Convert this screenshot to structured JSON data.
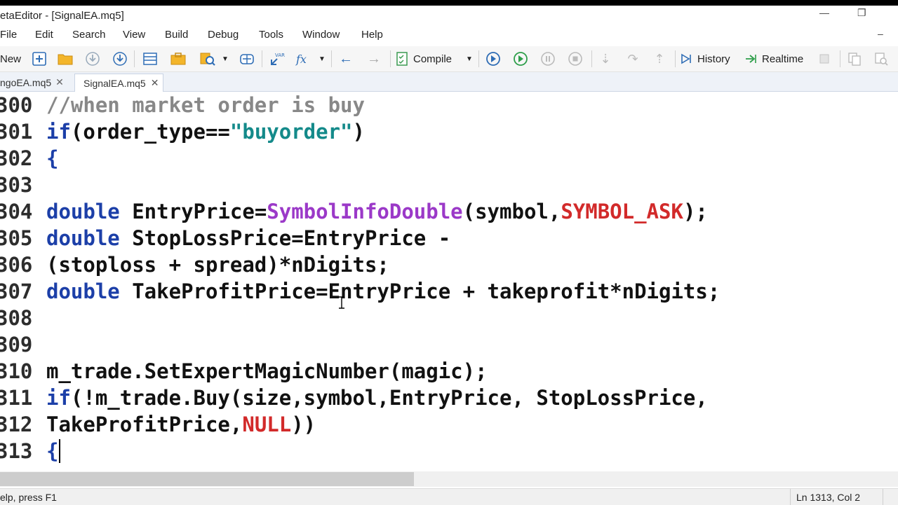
{
  "window": {
    "title": "etaEditor - [SignalEA.mq5]"
  },
  "menu": [
    "File",
    "Edit",
    "Search",
    "View",
    "Build",
    "Debug",
    "Tools",
    "Window",
    "Help"
  ],
  "toolbar": {
    "new_label": "New",
    "compile_label": "Compile",
    "history_label": "History",
    "realtime_label": "Realtime"
  },
  "tabs": [
    {
      "label": "ngoEA.mq5",
      "active": false
    },
    {
      "label": "SignalEA.mq5",
      "active": true
    }
  ],
  "code_lines": [
    {
      "num": "300",
      "segments": [
        {
          "t": "//when market order is buy",
          "c": "c"
        }
      ]
    },
    {
      "num": "301",
      "segments": [
        {
          "t": "if",
          "c": "k"
        },
        {
          "t": "(order_type==",
          "c": ""
        },
        {
          "t": "\"buyorder\"",
          "c": "s"
        },
        {
          "t": ")",
          "c": ""
        }
      ]
    },
    {
      "num": "302",
      "segments": [
        {
          "t": "{",
          "c": "k"
        }
      ]
    },
    {
      "num": "303",
      "segments": []
    },
    {
      "num": "304",
      "segments": [
        {
          "t": "double",
          "c": "k"
        },
        {
          "t": " EntryPrice=",
          "c": ""
        },
        {
          "t": "SymbolInfoDouble",
          "c": "f"
        },
        {
          "t": "(symbol,",
          "c": ""
        },
        {
          "t": "SYMBOL_ASK",
          "c": "r"
        },
        {
          "t": ");",
          "c": ""
        }
      ]
    },
    {
      "num": "305",
      "segments": [
        {
          "t": "double",
          "c": "k"
        },
        {
          "t": " StopLossPrice=EntryPrice -",
          "c": ""
        }
      ]
    },
    {
      "num": "306",
      "segments": [
        {
          "t": "(stoploss + spread)*nDigits;",
          "c": ""
        }
      ]
    },
    {
      "num": "307",
      "segments": [
        {
          "t": "double",
          "c": "k"
        },
        {
          "t": " TakeProfitPrice=EntryPrice + takeprofit*nDigits;",
          "c": ""
        }
      ]
    },
    {
      "num": "308",
      "segments": []
    },
    {
      "num": "309",
      "segments": []
    },
    {
      "num": "310",
      "segments": [
        {
          "t": "m_trade.SetExpertMagicNumber(magic);",
          "c": ""
        }
      ]
    },
    {
      "num": "311",
      "segments": [
        {
          "t": "if",
          "c": "k"
        },
        {
          "t": "(!m_trade.Buy(size,symbol,EntryPrice, StopLossPrice,",
          "c": ""
        }
      ]
    },
    {
      "num": "312",
      "segments": [
        {
          "t": "TakeProfitPrice,",
          "c": ""
        },
        {
          "t": "NULL",
          "c": "r"
        },
        {
          "t": "))",
          "c": ""
        }
      ]
    },
    {
      "num": "313",
      "segments": [
        {
          "t": "{",
          "c": "k"
        }
      ]
    }
  ],
  "status": {
    "left": "elp, press F1",
    "position": "Ln 1313, Col 2"
  },
  "colors": {
    "keyword": "#1c3fa8",
    "string": "#148a8a",
    "function": "#9b39c8",
    "comment": "#888888",
    "constant": "#d22a2a"
  }
}
